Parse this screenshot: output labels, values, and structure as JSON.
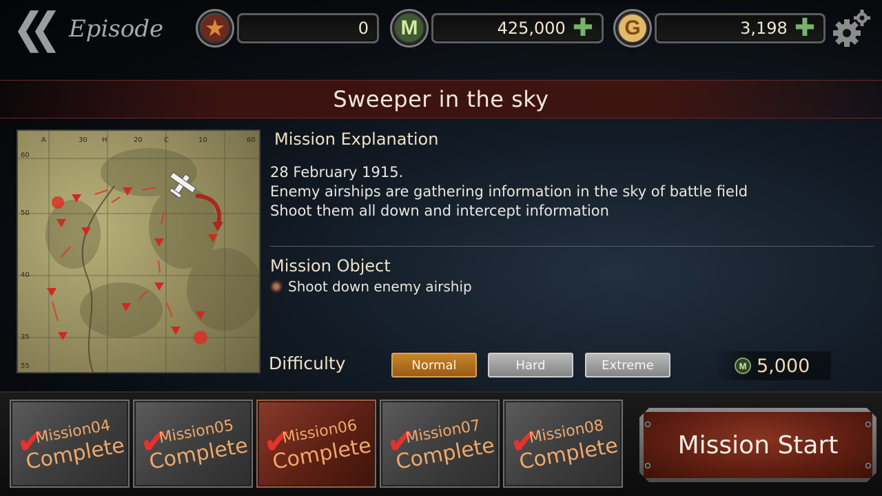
{
  "header": {
    "back_chevron": "❮❮",
    "title": "Episode",
    "currencies": [
      {
        "icon": "star-icon",
        "symbol": "★",
        "value": "0",
        "has_plus": false,
        "color": "#d98a3a",
        "bg": "#6b2a1c"
      },
      {
        "icon": "m-coin-icon",
        "symbol": "M",
        "value": "425,000",
        "has_plus": true,
        "color": "#d7e8a8",
        "bg": "#3f5b32"
      },
      {
        "icon": "g-coin-icon",
        "symbol": "G",
        "value": "3,198",
        "has_plus": true,
        "color": "#7a4c12",
        "bg": "#e2b968"
      }
    ],
    "plus_symbol": "✚"
  },
  "mission": {
    "title": "Sweeper in the sky",
    "explanation_heading": "Mission Explanation",
    "explanation_lines": [
      "28 February 1915.",
      "Enemy airships are gathering information in the sky of battle field",
      "Shoot them all down and intercept information"
    ],
    "object_heading": "Mission Object",
    "objective": "Shoot down enemy airship"
  },
  "map": {
    "col_labels": [
      "A",
      "30",
      "H",
      "20",
      "C",
      "10",
      "60"
    ],
    "row_labels": [
      "60",
      "50",
      "40",
      "35",
      "55"
    ]
  },
  "difficulty": {
    "label": "Difficulty",
    "options": [
      "Normal",
      "Hard",
      "Extreme"
    ],
    "selected": "Normal",
    "cost_symbol": "M",
    "cost": "5,000"
  },
  "missions": [
    {
      "name": "Mission04",
      "status": "Complete",
      "selected": false
    },
    {
      "name": "Mission05",
      "status": "Complete",
      "selected": false
    },
    {
      "name": "Mission06",
      "status": "Complete",
      "selected": true
    },
    {
      "name": "Mission07",
      "status": "Complete",
      "selected": false
    },
    {
      "name": "Mission08",
      "status": "Complete",
      "selected": false
    }
  ],
  "check_symbol": "✔",
  "start_label": "Mission Start"
}
